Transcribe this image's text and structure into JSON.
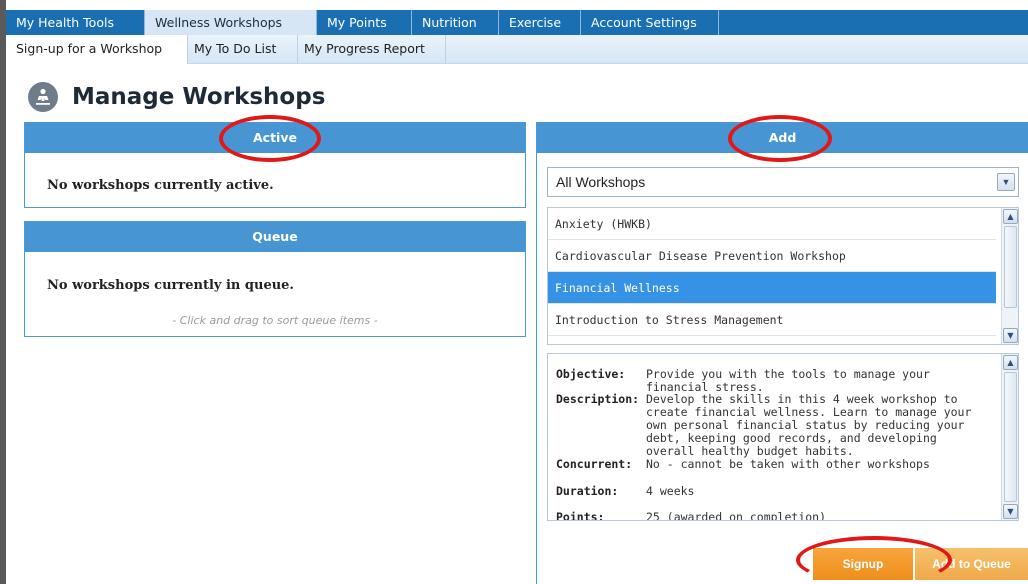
{
  "top_nav": {
    "tabs": [
      {
        "label": "My Health Tools"
      },
      {
        "label": "Wellness Workshops",
        "active": true
      },
      {
        "label": "My Points"
      },
      {
        "label": "Nutrition"
      },
      {
        "label": "Exercise"
      },
      {
        "label": "Account Settings"
      }
    ]
  },
  "sub_nav": {
    "tabs": [
      {
        "label": "Sign-up for a Workshop",
        "active": true
      },
      {
        "label": "My To Do List"
      },
      {
        "label": "My Progress Report"
      }
    ]
  },
  "page": {
    "title": "Manage Workshops",
    "icon": "meditation-person-icon"
  },
  "active_panel": {
    "title": "Active",
    "message": "No workshops currently active."
  },
  "queue_panel": {
    "title": "Queue",
    "message": "No workshops currently in queue.",
    "hint": "- Click and drag to sort queue items -"
  },
  "add_panel": {
    "title": "Add",
    "filter_value": "All Workshops",
    "workshops": [
      {
        "name": "Anxiety (HWKB)"
      },
      {
        "name": "Cardiovascular Disease Prevention Workshop"
      },
      {
        "name": "Financial Wellness",
        "selected": true
      },
      {
        "name": "Introduction to Stress Management"
      }
    ],
    "details": {
      "objective_label": "Objective:",
      "objective": "Provide you with the tools to manage your financial stress.",
      "description_label": "Description:",
      "description": "Develop the skills in this 4 week workshop to create financial wellness. Learn to manage your own personal financial status by reducing your debt, keeping good records, and developing overall healthy budget habits.",
      "concurrent_label": "Concurrent:",
      "concurrent": "No - cannot be taken with other workshops",
      "duration_label": "Duration:",
      "duration": "4 weeks",
      "points_label": "Points:",
      "points": "25 (awarded on completion)"
    },
    "signup_label": "Signup",
    "add_to_queue_label": "Add to Queue"
  },
  "colors": {
    "nav_blue": "#1a6fb3",
    "panel_header": "#4796d3",
    "selected_row": "#3592e4",
    "signup_orange": "#ef8e1c",
    "annotation_red": "#e01818"
  }
}
